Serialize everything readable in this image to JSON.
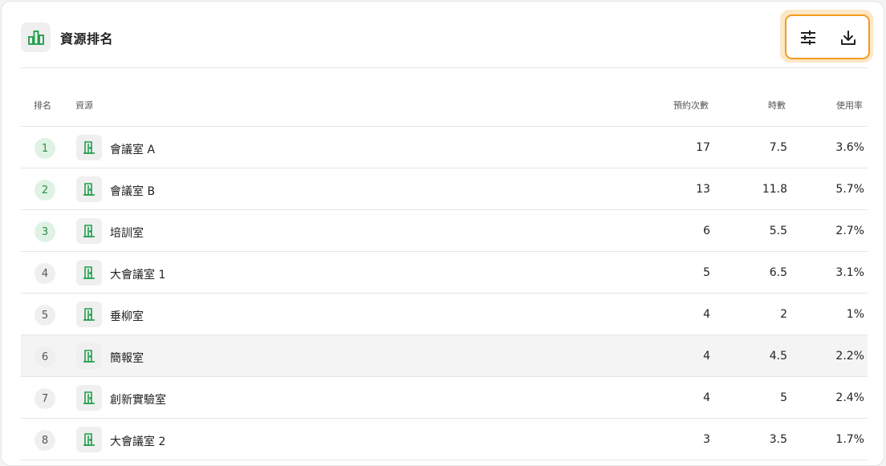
{
  "header": {
    "title": "資源排名",
    "icon": "bar-chart-icon",
    "actions": [
      {
        "name": "filter-button",
        "icon": "tune-sliders-icon"
      },
      {
        "name": "download-button",
        "icon": "download-icon"
      }
    ]
  },
  "colors": {
    "accent_green": "#1f9d4a",
    "rank_top_bg": "#dff3e4",
    "highlight_border": "#f49b1c"
  },
  "table": {
    "columns": {
      "rank": "排名",
      "resource": "資源",
      "bookings": "預約次數",
      "hours": "時數",
      "usage": "使用率"
    },
    "rows": [
      {
        "rank": "1",
        "name": "會議室 A",
        "bookings": "17",
        "hours": "7.5",
        "usage": "3.6%"
      },
      {
        "rank": "2",
        "name": "會議室 B",
        "bookings": "13",
        "hours": "11.8",
        "usage": "5.7%"
      },
      {
        "rank": "3",
        "name": "培訓室",
        "bookings": "6",
        "hours": "5.5",
        "usage": "2.7%"
      },
      {
        "rank": "4",
        "name": "大會議室 1",
        "bookings": "5",
        "hours": "6.5",
        "usage": "3.1%"
      },
      {
        "rank": "5",
        "name": "垂柳室",
        "bookings": "4",
        "hours": "2",
        "usage": "1%"
      },
      {
        "rank": "6",
        "name": "簡報室",
        "bookings": "4",
        "hours": "4.5",
        "usage": "2.2%"
      },
      {
        "rank": "7",
        "name": "創新實驗室",
        "bookings": "4",
        "hours": "5",
        "usage": "2.4%"
      },
      {
        "rank": "8",
        "name": "大會議室 2",
        "bookings": "3",
        "hours": "3.5",
        "usage": "1.7%"
      }
    ]
  }
}
